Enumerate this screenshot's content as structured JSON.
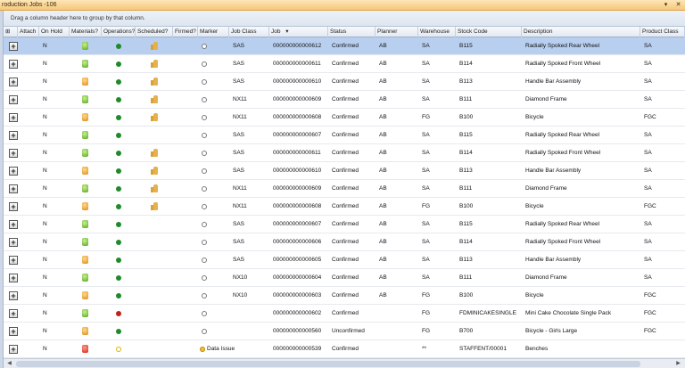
{
  "window": {
    "title": "roduction Jobs -106",
    "minimize": "▾",
    "close": "✕"
  },
  "group_hint": "Drag a column header here to group by that column.",
  "columns": {
    "expand": "⊞",
    "attach": "Attach",
    "on_hold": "On Hold",
    "materials": "Materials?",
    "operations": "Operations?",
    "scheduled": "Scheduled?",
    "firmed": "Firmed?",
    "marker": "Marker",
    "job_class": "Job Class",
    "job": "Job",
    "job_sort": "▾",
    "status": "Status",
    "planner": "Planner",
    "warehouse": "Warehouse",
    "stock_code": "Stock Code",
    "description": "Description",
    "product_class": "Product Class"
  },
  "rows": [
    {
      "on_hold": "N",
      "materials": "green",
      "operations": "green",
      "scheduled": true,
      "job_class": "SAS",
      "job": "000000000000612",
      "status": "Confirmed",
      "planner": "AB",
      "warehouse": "SA",
      "stock_code": "B115",
      "description": "Radially Spoked Rear Wheel",
      "product_class": "SA",
      "selected": true
    },
    {
      "on_hold": "N",
      "materials": "green",
      "operations": "green",
      "scheduled": true,
      "job_class": "SAS",
      "job": "000000000000611",
      "status": "Confirmed",
      "planner": "AB",
      "warehouse": "SA",
      "stock_code": "B114",
      "description": "Radially Spoked Front Wheel",
      "product_class": "SA"
    },
    {
      "on_hold": "N",
      "materials": "orange",
      "operations": "green",
      "scheduled": true,
      "job_class": "SAS",
      "job": "000000000000610",
      "status": "Confirmed",
      "planner": "AB",
      "warehouse": "SA",
      "stock_code": "B113",
      "description": "Handle Bar Assembly",
      "product_class": "SA"
    },
    {
      "on_hold": "N",
      "materials": "green",
      "operations": "green",
      "scheduled": true,
      "job_class": "NX11",
      "job": "000000000000609",
      "status": "Confirmed",
      "planner": "AB",
      "warehouse": "SA",
      "stock_code": "B111",
      "description": "Diamond Frame",
      "product_class": "SA"
    },
    {
      "on_hold": "N",
      "materials": "orange",
      "operations": "green",
      "scheduled": true,
      "job_class": "NX11",
      "job": "000000000000608",
      "status": "Confirmed",
      "planner": "AB",
      "warehouse": "FG",
      "stock_code": "B100",
      "description": "Bicycle",
      "product_class": "FGC"
    },
    {
      "on_hold": "N",
      "materials": "green",
      "operations": "green",
      "scheduled": false,
      "job_class": "SAS",
      "job": "000000000000607",
      "status": "Confirmed",
      "planner": "AB",
      "warehouse": "SA",
      "stock_code": "B115",
      "description": "Radially Spoked Rear Wheel",
      "product_class": "SA"
    },
    {
      "on_hold": "N",
      "materials": "green",
      "operations": "green",
      "scheduled": true,
      "job_class": "SAS",
      "job": "000000000000611",
      "status": "Confirmed",
      "planner": "AB",
      "warehouse": "SA",
      "stock_code": "B114",
      "description": "Radially Spoked Front Wheel",
      "product_class": "SA"
    },
    {
      "on_hold": "N",
      "materials": "orange",
      "operations": "green",
      "scheduled": true,
      "job_class": "SAS",
      "job": "000000000000610",
      "status": "Confirmed",
      "planner": "AB",
      "warehouse": "SA",
      "stock_code": "B113",
      "description": "Handle Bar Assembly",
      "product_class": "SA"
    },
    {
      "on_hold": "N",
      "materials": "green",
      "operations": "green",
      "scheduled": true,
      "job_class": "NX11",
      "job": "000000000000609",
      "status": "Confirmed",
      "planner": "AB",
      "warehouse": "SA",
      "stock_code": "B111",
      "description": "Diamond Frame",
      "product_class": "SA"
    },
    {
      "on_hold": "N",
      "materials": "orange",
      "operations": "green",
      "scheduled": true,
      "job_class": "NX11",
      "job": "000000000000608",
      "status": "Confirmed",
      "planner": "AB",
      "warehouse": "FG",
      "stock_code": "B100",
      "description": "Bicycle",
      "product_class": "FGC"
    },
    {
      "on_hold": "N",
      "materials": "green",
      "operations": "green",
      "scheduled": false,
      "job_class": "SAS",
      "job": "000000000000607",
      "status": "Confirmed",
      "planner": "AB",
      "warehouse": "SA",
      "stock_code": "B115",
      "description": "Radially Spoked Rear Wheel",
      "product_class": "SA"
    },
    {
      "on_hold": "N",
      "materials": "green",
      "operations": "green",
      "scheduled": false,
      "job_class": "SAS",
      "job": "000000000000606",
      "status": "Confirmed",
      "planner": "AB",
      "warehouse": "SA",
      "stock_code": "B114",
      "description": "Radially Spoked Front Wheel",
      "product_class": "SA"
    },
    {
      "on_hold": "N",
      "materials": "orange",
      "operations": "green",
      "scheduled": false,
      "job_class": "SAS",
      "job": "000000000000605",
      "status": "Confirmed",
      "planner": "AB",
      "warehouse": "SA",
      "stock_code": "B113",
      "description": "Handle Bar Assembly",
      "product_class": "SA"
    },
    {
      "on_hold": "N",
      "materials": "green",
      "operations": "green",
      "scheduled": false,
      "job_class": "NX10",
      "job": "000000000000604",
      "status": "Confirmed",
      "planner": "AB",
      "warehouse": "SA",
      "stock_code": "B111",
      "description": "Diamond Frame",
      "product_class": "SA"
    },
    {
      "on_hold": "N",
      "materials": "orange",
      "operations": "green",
      "scheduled": false,
      "job_class": "NX10",
      "job": "000000000000603",
      "status": "Confirmed",
      "planner": "AB",
      "warehouse": "FG",
      "stock_code": "B100",
      "description": "Bicycle",
      "product_class": "FGC"
    },
    {
      "on_hold": "N",
      "materials": "green",
      "operations": "red",
      "scheduled": false,
      "job_class": "",
      "job": "000000000000602",
      "status": "Confirmed",
      "planner": "",
      "warehouse": "FG",
      "stock_code": "FDMINICAKESINGLE",
      "description": "Mini Cake Chocolate Single Pack",
      "product_class": "FGC"
    },
    {
      "on_hold": "N",
      "materials": "orange",
      "operations": "green",
      "scheduled": false,
      "job_class": "",
      "job": "000000000000560",
      "status": "Unconfirmed",
      "planner": "",
      "warehouse": "FG",
      "stock_code": "B700",
      "description": "Bicycle - Girls Large",
      "product_class": "FGC"
    },
    {
      "on_hold": "N",
      "materials": "red",
      "operations": "yellow",
      "scheduled": false,
      "marker": "Data Issue",
      "job_class": "",
      "job": "000000000000539",
      "status": "Confirmed",
      "planner": "",
      "warehouse": "**",
      "stock_code": "STAFFENT/00001",
      "description": "Benches",
      "product_class": ""
    }
  ]
}
